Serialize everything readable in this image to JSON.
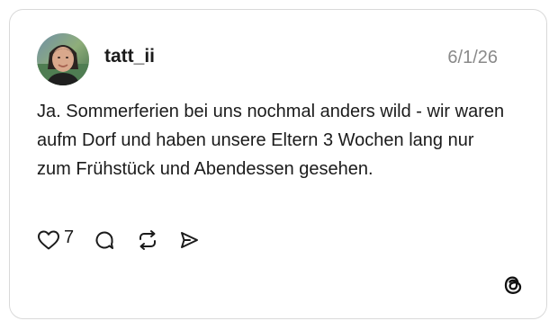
{
  "post": {
    "username": "tatt_ii",
    "date": "6/1/26",
    "text": "Ja. Sommerferien bei uns nochmal anders wild - wir waren aufm Dorf und haben unsere Eltern 3 Wochen lang nur zum Frühstück und Abendessen gesehen.",
    "likes": "7"
  },
  "icons": {
    "like": "heart-icon",
    "reply": "comment-icon",
    "repost": "repost-icon",
    "share": "send-icon",
    "brand": "threads-logo-icon"
  },
  "colors": {
    "text": "#1b1b1b",
    "muted": "#8a8a8a",
    "border": "#d9d9d9"
  }
}
